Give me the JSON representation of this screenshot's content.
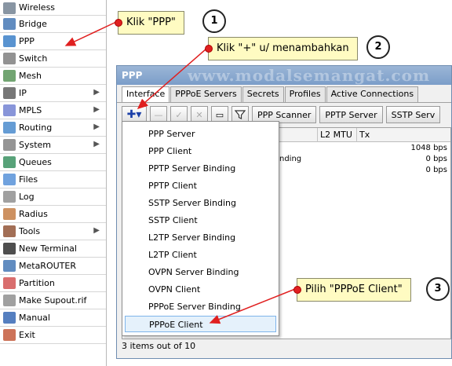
{
  "sidebar": {
    "items": [
      {
        "label": "Wireless",
        "icon": "wireless-icon",
        "submenu": false
      },
      {
        "label": "Bridge",
        "icon": "bridge-icon",
        "submenu": false
      },
      {
        "label": "PPP",
        "icon": "ppp-icon",
        "submenu": false
      },
      {
        "label": "Switch",
        "icon": "switch-icon",
        "submenu": false
      },
      {
        "label": "Mesh",
        "icon": "mesh-icon",
        "submenu": false
      },
      {
        "label": "IP",
        "icon": "ip-icon",
        "submenu": true
      },
      {
        "label": "MPLS",
        "icon": "mpls-icon",
        "submenu": true
      },
      {
        "label": "Routing",
        "icon": "routing-icon",
        "submenu": true
      },
      {
        "label": "System",
        "icon": "system-icon",
        "submenu": true
      },
      {
        "label": "Queues",
        "icon": "queues-icon",
        "submenu": false
      },
      {
        "label": "Files",
        "icon": "files-icon",
        "submenu": false
      },
      {
        "label": "Log",
        "icon": "log-icon",
        "submenu": false
      },
      {
        "label": "Radius",
        "icon": "radius-icon",
        "submenu": false
      },
      {
        "label": "Tools",
        "icon": "tools-icon",
        "submenu": true
      },
      {
        "label": "New Terminal",
        "icon": "terminal-icon",
        "submenu": false
      },
      {
        "label": "MetaROUTER",
        "icon": "metarouter-icon",
        "submenu": false
      },
      {
        "label": "Partition",
        "icon": "partition-icon",
        "submenu": false
      },
      {
        "label": "Make Supout.rif",
        "icon": "supout-icon",
        "submenu": false
      },
      {
        "label": "Manual",
        "icon": "manual-icon",
        "submenu": false
      },
      {
        "label": "Exit",
        "icon": "exit-icon",
        "submenu": false
      }
    ],
    "submenu_glyph": "▶"
  },
  "window": {
    "title": "PPP",
    "watermark": "www.modalsemangat.com",
    "tabs": [
      "Interface",
      "PPPoE Servers",
      "Secrets",
      "Profiles",
      "Active Connections"
    ],
    "active_tab": "Interface",
    "toolbar": {
      "plus": "✚▾",
      "minus": "—",
      "check": "✓",
      "cross": "✕",
      "comment": "▭",
      "filter": "▼",
      "buttons": [
        "PPP Scanner",
        "PPTP Server",
        "SSTP Serv"
      ]
    },
    "table": {
      "columns": [
        "L2 MTU",
        "Tx"
      ],
      "rows": [
        {
          "name": "",
          "tx": "1048 bps"
        },
        {
          "name": "nding",
          "tx": "0 bps"
        },
        {
          "name": "",
          "tx": "0 bps"
        }
      ]
    },
    "status": "3 items out of 10"
  },
  "menu": {
    "items": [
      "PPP Server",
      "PPP Client",
      "PPTP Server Binding",
      "PPTP Client",
      "SSTP Server Binding",
      "SSTP Client",
      "L2TP Server Binding",
      "L2TP Client",
      "OVPN Server Binding",
      "OVPN Client",
      "PPPoE Server Binding",
      "PPPoE Client"
    ],
    "selected": "PPPoE Client"
  },
  "callouts": [
    {
      "text": "Klik \"PPP\"",
      "number": "1"
    },
    {
      "text": "Klik \"+\" u/ menambahkan",
      "number": "2"
    },
    {
      "text": "Pilih \"PPPoE Client\"",
      "number": "3"
    }
  ],
  "colors": {
    "arrow": "#e02020",
    "callout_bg": "#fffbc2",
    "plus": "#1b3fa8",
    "title_bar": "#8aa9d0"
  }
}
